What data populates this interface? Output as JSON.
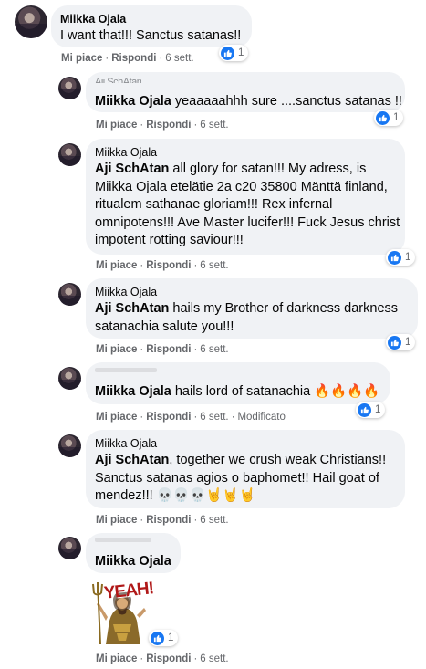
{
  "comments": [
    {
      "author": "Miikka Ojala",
      "text": "I want that!!! Sanctus satanas!!",
      "like": "Mi piace",
      "reply": "Rispondi",
      "time": "6 sett.",
      "reactions": "1"
    },
    {
      "author": "Aji SchAtan",
      "mention": "Miikka Ojala",
      "text": " yeaaaaahhh sure ....sanctus satanas !!",
      "like": "Mi piace",
      "reply": "Rispondi",
      "time": "6 sett.",
      "reactions": "1"
    },
    {
      "author": "Miikka Ojala",
      "mention": "Aji SchAtan",
      "line1": " all glory for satan!!! My adress, is",
      "line2": "Miikka Ojala etelätie 2a c20 35800 Mänttä finland,",
      "line3": "ritualem sathanae gloriam!!! Rex infernal",
      "line4": "omnipotens!!! Ave Master lucifer!!! Fuck Jesus christ",
      "line5": "impotent rotting saviour!!!",
      "like": "Mi piace",
      "reply": "Rispondi",
      "time": "6 sett.",
      "reactions": "1"
    },
    {
      "author": "Miikka Ojala",
      "mention": "Aji SchAtan",
      "line1": " hails my Brother of darkness darkness",
      "line2": "satanachia salute you!!!",
      "like": "Mi piace",
      "reply": "Rispondi",
      "time": "6 sett.",
      "reactions": "1"
    },
    {
      "mention": "Miikka Ojala",
      "text": " hails lord of satanachia 🔥🔥🔥🔥",
      "like": "Mi piace",
      "reply": "Rispondi",
      "time": "6 sett.",
      "edited": "Modificato",
      "reactions": "1"
    },
    {
      "author": "Miikka Ojala",
      "mention": "Aji SchAtan",
      "line1": ", together we crush weak Christians!!",
      "line2": "Sanctus satanas agios o baphomet!! Hail goat of",
      "line3": "mendez!!! 💀💀💀🤘🤘🤘",
      "like": "Mi piace",
      "reply": "Rispondi",
      "time": "6 sett."
    },
    {
      "mention": "Miikka Ojala",
      "gif_text": "YEAH!",
      "like": "Mi piace",
      "reply": "Rispondi",
      "time": "6 sett.",
      "reactions": "1"
    }
  ],
  "colors": {
    "bubble": "#f0f2f5",
    "like_blue": "#1877f2",
    "meta": "#65676b"
  },
  "icons": {
    "reaction": "thumbs-up-icon"
  }
}
